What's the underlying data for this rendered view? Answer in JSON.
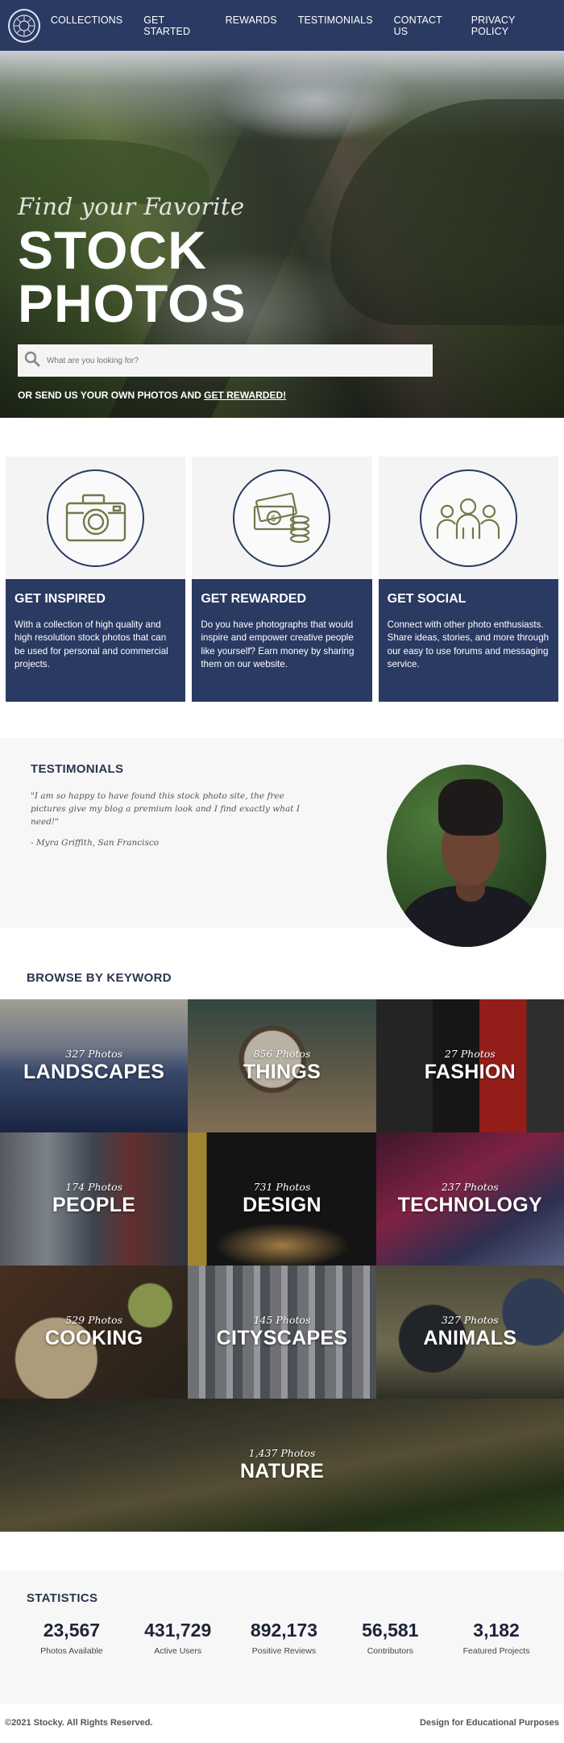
{
  "nav": {
    "links": [
      "COLLECTIONS",
      "GET STARTED",
      "REWARDS",
      "TESTIMONIALS",
      "CONTACT US",
      "PRIVACY POLICY"
    ]
  },
  "hero": {
    "subtitle": "Find your Favorite",
    "title": "STOCK PHOTOS",
    "search_placeholder": "What are you looking for?",
    "cta_text": "OR SEND US YOUR OWN PHOTOS AND ",
    "cta_link": "GET REWARDED!"
  },
  "features": [
    {
      "icon": "camera-icon",
      "title": "GET INSPIRED",
      "text": "With a collection of high quality and high resolution stock photos that can be used for personal and commercial projects."
    },
    {
      "icon": "money-icon",
      "title": "GET REWARDED",
      "text": "Do you have photographs that would inspire and empower creative people like yourself? Earn money by sharing them on our website."
    },
    {
      "icon": "people-icon",
      "title": "GET SOCIAL",
      "text": "Connect with other photo enthusiasts. Share ideas, stories, and more through our easy to use forums and messaging service."
    }
  ],
  "testimonials": {
    "heading": "TESTIMONIALS",
    "quote": "\"I am so happy to have found this stock photo site, the free pictures give my blog a premium look and I find exactly what I need!\"",
    "author": "- Myra Griffith, San Francisco"
  },
  "keywords": {
    "heading": "BROWSE BY KEYWORD",
    "tiles": [
      {
        "count": "327 Photos",
        "name": "LANDSCAPES"
      },
      {
        "count": "856 Photos",
        "name": "THINGS"
      },
      {
        "count": "27 Photos",
        "name": "FASHION"
      },
      {
        "count": "174 Photos",
        "name": "PEOPLE"
      },
      {
        "count": "731 Photos",
        "name": "DESIGN"
      },
      {
        "count": "237 Photos",
        "name": "TECHNOLOGY"
      },
      {
        "count": "529 Photos",
        "name": "COOKING"
      },
      {
        "count": "145 Photos",
        "name": "CITYSCAPES"
      },
      {
        "count": "327 Photos",
        "name": "ANIMALS"
      },
      {
        "count": "1,437 Photos",
        "name": "NATURE"
      }
    ]
  },
  "stats": {
    "heading": "STATISTICS",
    "items": [
      {
        "num": "23,567",
        "label": "Photos Available"
      },
      {
        "num": "431,729",
        "label": "Active Users"
      },
      {
        "num": "892,173",
        "label": "Positive Reviews"
      },
      {
        "num": "56,581",
        "label": "Contributors"
      },
      {
        "num": "3,182",
        "label": "Featured Projects"
      }
    ]
  },
  "footer": {
    "copyright": "©2021 Stocky. All Rights Reserved.",
    "note": "Design for Educational Purposes"
  },
  "colors": {
    "navy": "#2a3a63",
    "light_gray": "#f4f4f4",
    "icon_green": "#6f7a4a"
  }
}
